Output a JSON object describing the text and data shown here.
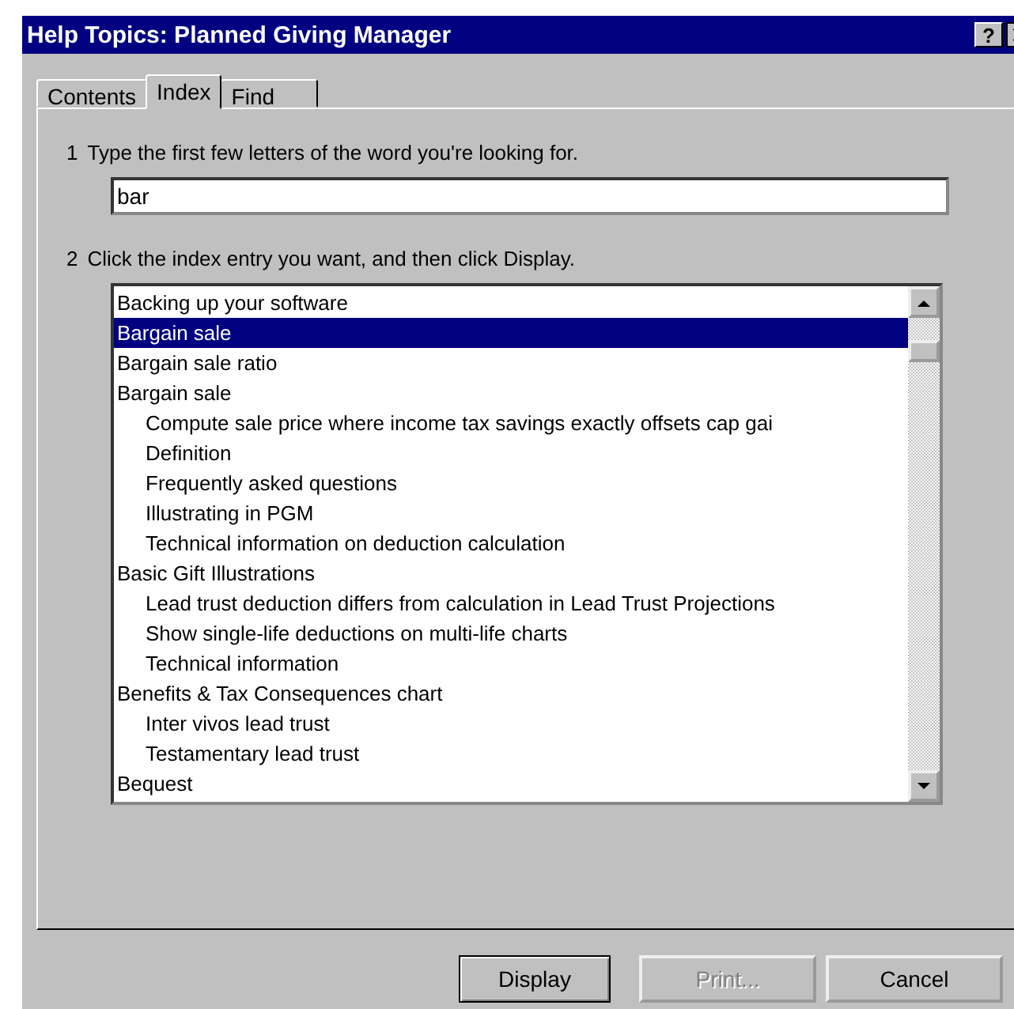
{
  "window": {
    "title": "Help Topics: Planned Giving Manager",
    "help_button": "?"
  },
  "tabs": [
    {
      "label": "Contents",
      "selected": false
    },
    {
      "label": "Index",
      "selected": true
    },
    {
      "label": "Find",
      "selected": false
    }
  ],
  "step_1": {
    "number": "1",
    "text": "Type the first few letters of the word you're looking for."
  },
  "search": {
    "value": "bar"
  },
  "step_2": {
    "number": "2",
    "text": "Click the index entry you want, and then click Display."
  },
  "index_entries": [
    {
      "label": "Backing up your software",
      "selected": false
    },
    {
      "label": "Bargain sale",
      "selected": true
    },
    {
      "label": "Bargain sale ratio",
      "selected": false
    },
    {
      "label": "Bargain sale",
      "selected": false,
      "children": [
        {
          "label": "Compute sale price where income tax savings exactly offsets cap gai",
          "selected": false
        },
        {
          "label": "Definition",
          "selected": false
        },
        {
          "label": "Frequently asked questions",
          "selected": false
        },
        {
          "label": "Illustrating in PGM",
          "selected": false
        },
        {
          "label": "Technical information on deduction calculation",
          "selected": false
        }
      ]
    },
    {
      "label": "Basic Gift Illustrations",
      "selected": false,
      "children": [
        {
          "label": "Lead trust deduction differs from calculation in Lead Trust Projections",
          "selected": false
        },
        {
          "label": "Show single-life deductions on multi-life charts",
          "selected": false
        },
        {
          "label": "Technical information",
          "selected": false
        }
      ]
    },
    {
      "label": "Benefits & Tax Consequences chart",
      "selected": false,
      "children": [
        {
          "label": "Inter vivos lead trust",
          "selected": false
        },
        {
          "label": "Testamentary lead trust",
          "selected": false
        }
      ]
    },
    {
      "label": "Bequest",
      "selected": false
    }
  ],
  "buttons": [
    {
      "label": "Display",
      "disabled": false
    },
    {
      "label": "Print...",
      "disabled": true
    },
    {
      "label": "Cancel",
      "disabled": false
    }
  ]
}
